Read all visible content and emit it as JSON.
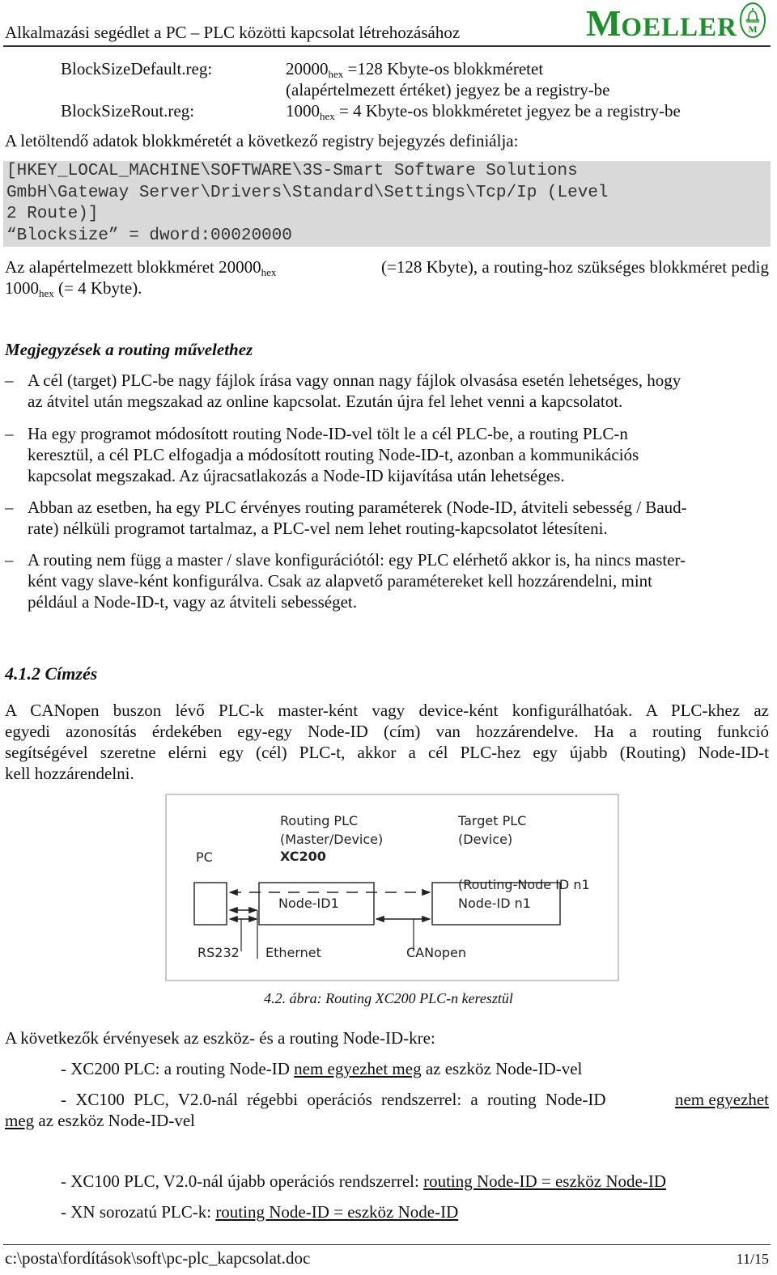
{
  "header": {
    "title": "Alkalmazási segédlet a PC – PLC közötti kapcsolat létrehozásához",
    "logo_big": "M",
    "logo_small": "OELLER",
    "logo_mark_text": "M"
  },
  "reg_files": [
    {
      "name": "BlockSizeDefault.reg:",
      "value_num": "20000",
      "value_sub": "hex",
      "value_rest": " =128 Kbyte-os blokkméretet",
      "value_line2": "(alapértelmezett értéket) jegyez be a registry-be"
    },
    {
      "name": "BlockSizeRout.reg:",
      "value_num": "1000",
      "value_sub": "hex",
      "value_rest": " = 4 Kbyte-os blokkméretet jegyez be a registry-be"
    }
  ],
  "intro": "A letöltendő adatok blokkméretét a következő registry bejegyzés definiálja:",
  "code_lines": [
    "[HKEY_LOCAL_MACHINE\\SOFTWARE\\3S-Smart Software Solutions",
    "GmbH\\Gateway Server\\Drivers\\Standard\\Settings\\Tcp/Ip (Level",
    "2 Route)]",
    "“Blocksize” = dword:00020000"
  ],
  "blocksize_para": {
    "p1": "Az alapértelmezett blokkméret 20000",
    "sub1": "hex",
    "p2": " (=128 Kbyte), a routing-hoz szükséges blokkméret pedig",
    "p3": "1000",
    "sub2": "hex",
    "p4": " (= 4 Kbyte)."
  },
  "notes": {
    "heading": "Megjegyzések a routing művelethez",
    "dash": "–",
    "items": [
      [
        "A cél (target) PLC-be nagy fájlok írása vagy onnan nagy fájlok olvasása esetén lehetséges, hogy",
        "az átvitel után megszakad az online kapcsolat. Ezután újra fel lehet venni a kapcsolatot."
      ],
      [
        "Ha egy programot módosított routing Node-ID-vel tölt le a cél PLC-be, a routing PLC-n",
        "keresztül, a cél PLC elfogadja a módosított routing Node-ID-t, azonban a kommunikációs",
        "kapcsolat megszakad. Az újracsatlakozás a Node-ID kijavítása után lehetséges."
      ],
      [
        "Abban az esetben, ha egy PLC érvényes routing paraméterek (Node-ID, átviteli sebesség / Baud-",
        "rate) nélküli programot tartalmaz, a PLC-vel nem lehet routing-kapcsolatot létesíteni."
      ],
      [
        "A routing nem függ a master / slave konfigurációtól: egy PLC elérhető akkor is, ha nincs master-",
        "ként vagy slave-ként konfigurálva. Csak az alapvető paramétereket kell hozzárendelni, mint",
        "például a Node-ID-t, vagy az átviteli sebességet."
      ]
    ]
  },
  "section": {
    "heading": "4.1.2 Címzés",
    "para": [
      "A CANopen buszon lévő PLC-k master-ként vagy device-ként konfigurálhatóak. A PLC-khez az",
      "egyedi azonosítás érdekében egy-egy Node-ID (cím) van hozzárendelve. Ha a routing funkció",
      "segítségével szeretne elérni egy (cél) PLC-t, akkor a cél PLC-hez egy újabb (Routing) Node-ID-t",
      "kell hozzárendelni."
    ]
  },
  "diagram": {
    "pc_label": "PC",
    "routing_title": "Routing PLC",
    "routing_role": "(Master/Device)",
    "routing_model": "XC200",
    "routing_node": "Node-ID1",
    "target_title": "Target PLC",
    "target_role": "(Device)",
    "target_routing_node": "(Routing-Node ID n1",
    "target_node": "Node-ID n1",
    "bus_rs232": "RS232",
    "bus_ethernet": "Ethernet",
    "bus_canopen": "CANopen"
  },
  "caption": "4.2. ábra: Routing XC200 PLC-n keresztül",
  "rules_intro": "A következők érvényesek az eszköz- és a routing Node-ID-kre:",
  "rules": [
    {
      "pre": "- XC200 PLC: a routing Node-ID ",
      "u": "nem egyezhet meg",
      "post": " az eszköz Node-ID-vel"
    },
    {
      "pre": "- XC100 PLC, V2.0-nál régebbi operációs rendszerrel: a routing Node-ID ",
      "u": "nem egyezhet",
      "line2_u": "meg",
      "line2_post": " az eszköz Node-ID-vel"
    },
    {
      "pre": "- XC100 PLC, V2.0-nál újabb operációs rendszerrel: ",
      "u": "routing Node-ID = eszköz Node-ID",
      "post": ""
    },
    {
      "pre": "- XN sorozatú PLC-k: ",
      "u": "routing Node-ID = eszköz Node-ID",
      "post": ""
    }
  ],
  "footer": {
    "path": "c:\\posta\\fordítások\\soft\\pc-plc_kapcsolat.doc",
    "page": "11/15"
  }
}
